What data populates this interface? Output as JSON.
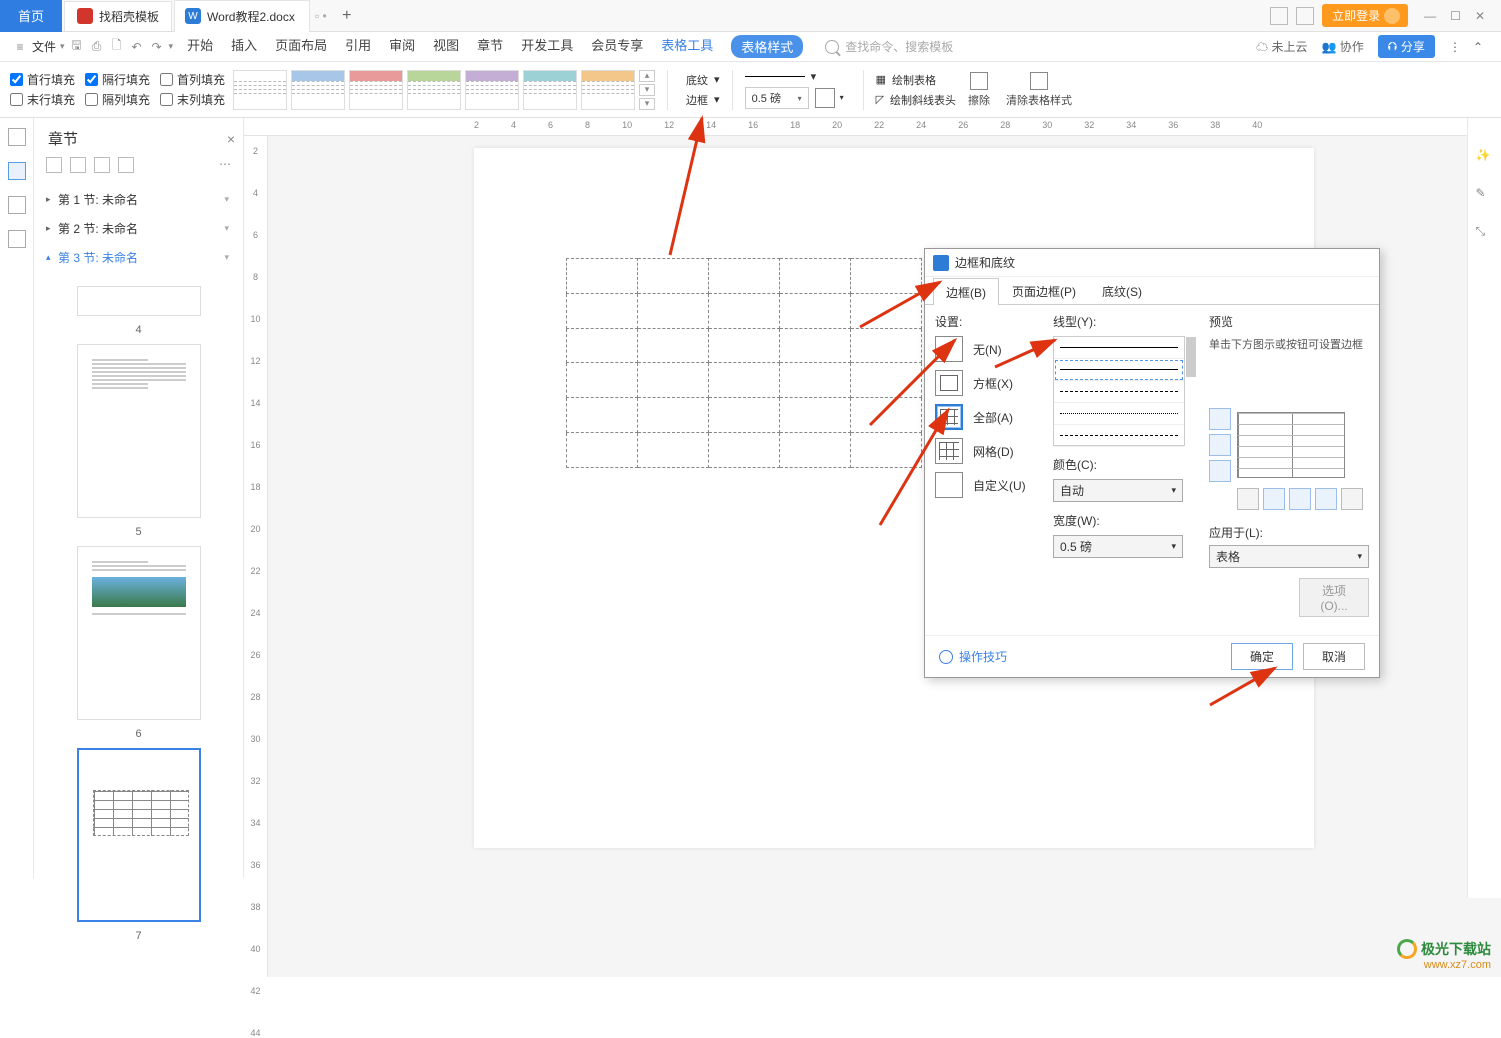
{
  "titlebar": {
    "home": "首页",
    "template_tab": "找稻壳模板",
    "doc_tab": "Word教程2.docx",
    "login": "立即登录"
  },
  "menubar": {
    "file": "文件",
    "menus": [
      "开始",
      "插入",
      "页面布局",
      "引用",
      "审阅",
      "视图",
      "章节",
      "开发工具",
      "会员专享"
    ],
    "highlight1": "表格工具",
    "highlight2": "表格样式",
    "search_ph": "查找命令、搜索模板",
    "cloud": "未上云",
    "collab": "协作",
    "share": "分享"
  },
  "ribbon": {
    "checks": {
      "r1c1": "首行填充",
      "r1c2": "隔行填充",
      "r1c3": "首列填充",
      "r2c1": "末行填充",
      "r2c2": "隔列填充",
      "r2c3": "末列填充"
    },
    "shading": "底纹",
    "border": "边框",
    "weight_val": "0.5",
    "weight_unit": "磅",
    "draw_table": "绘制表格",
    "draw_diag": "绘制斜线表头",
    "erase": "擦除",
    "clear_style": "清除表格样式"
  },
  "nav": {
    "title": "章节",
    "items": [
      {
        "label": "第 1 节: 未命名"
      },
      {
        "label": "第 2 节: 未命名"
      },
      {
        "label": "第 3 节: 未命名"
      }
    ],
    "pages": [
      "4",
      "5",
      "6",
      "7"
    ]
  },
  "dialog": {
    "title": "边框和底纹",
    "tabs": {
      "border": "边框(B)",
      "page_border": "页面边框(P)",
      "shading": "底纹(S)"
    },
    "settings_lbl": "设置:",
    "presets": {
      "none": "无(N)",
      "box": "方框(X)",
      "all": "全部(A)",
      "grid": "网格(D)",
      "custom": "自定义(U)"
    },
    "linetype_lbl": "线型(Y):",
    "color_lbl": "颜色(C):",
    "color_val": "自动",
    "width_lbl": "宽度(W):",
    "width_val": "0.5  磅",
    "preview_lbl": "预览",
    "preview_hint": "单击下方图示或按钮可设置边框",
    "apply_lbl": "应用于(L):",
    "apply_val": "表格",
    "options": "选项(O)...",
    "tips": "操作技巧",
    "ok": "确定",
    "cancel": "取消"
  },
  "ruler_h": [
    "2",
    "4",
    "6",
    "8",
    "10",
    "12",
    "14",
    "16",
    "18",
    "20",
    "22",
    "24",
    "26",
    "28",
    "30",
    "32",
    "34",
    "36",
    "38",
    "40"
  ],
  "ruler_v": [
    "2",
    "4",
    "6",
    "8",
    "10",
    "12",
    "14",
    "16",
    "18",
    "20",
    "22",
    "24",
    "26",
    "28",
    "30",
    "32",
    "34",
    "36",
    "38",
    "40",
    "42",
    "44"
  ],
  "watermark": {
    "line1": "极光下载站",
    "line2": "www.xz7.com"
  }
}
